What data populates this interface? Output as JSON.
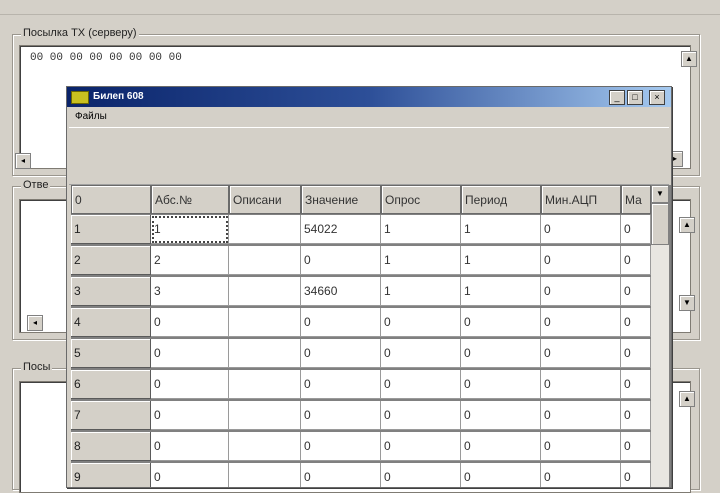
{
  "background": {
    "top_caption": "",
    "send_group_label": "Посылка ТХ (серверу)",
    "send_hex": "00 00 00 00 00 00 00 00",
    "answer_group_label": "Отве",
    "third_group_label": "Посы"
  },
  "window": {
    "title": "Билеп 608",
    "menu": {
      "file": "Файлы"
    },
    "buttons": {
      "minimize": "_",
      "maximize": "□",
      "close": "×"
    }
  },
  "grid": {
    "corner": "0",
    "columns": [
      "Абс.№",
      "Описани",
      "Значение",
      "Опрос",
      "Период",
      "Мин.АЦП",
      "Ма"
    ],
    "rows": [
      {
        "num": "1",
        "cells": [
          "1",
          "",
          "54022",
          "1",
          "1",
          "0",
          "0"
        ]
      },
      {
        "num": "2",
        "cells": [
          "2",
          "",
          "0",
          "1",
          "1",
          "0",
          "0"
        ]
      },
      {
        "num": "3",
        "cells": [
          "3",
          "",
          "34660",
          "1",
          "1",
          "0",
          "0"
        ]
      },
      {
        "num": "4",
        "cells": [
          "0",
          "",
          "0",
          "0",
          "0",
          "0",
          "0"
        ]
      },
      {
        "num": "5",
        "cells": [
          "0",
          "",
          "0",
          "0",
          "0",
          "0",
          "0"
        ]
      },
      {
        "num": "6",
        "cells": [
          "0",
          "",
          "0",
          "0",
          "0",
          "0",
          "0"
        ]
      },
      {
        "num": "7",
        "cells": [
          "0",
          "",
          "0",
          "0",
          "0",
          "0",
          "0"
        ]
      },
      {
        "num": "8",
        "cells": [
          "0",
          "",
          "0",
          "0",
          "0",
          "0",
          "0"
        ]
      },
      {
        "num": "9",
        "cells": [
          "0",
          "",
          "0",
          "0",
          "0",
          "0",
          "0"
        ]
      }
    ]
  },
  "colors": {
    "face": "#d4d0c8",
    "title_start": "#0a246a",
    "title_end": "#a6caf0"
  },
  "icons": {
    "app": "app-icon",
    "scroll_up": "scroll-up-icon",
    "scroll_down": "scroll-down-icon"
  }
}
